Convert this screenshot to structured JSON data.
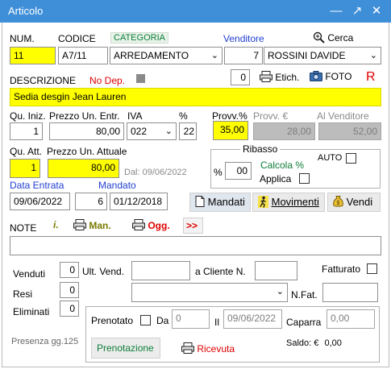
{
  "window": {
    "title": "Articolo",
    "min_glyph": "—",
    "max_glyph": "↗",
    "close_glyph": "✕"
  },
  "row1": {
    "num_label": "NUM.",
    "num_value": "11",
    "codice_label": "CODICE",
    "codice_value": "A7/11",
    "categoria_label": "CATEGORIA",
    "categoria_value": "ARREDAMENTO",
    "venditore_label": "Venditore",
    "venditore_num": "7",
    "venditore_name": "ROSSINI DAVIDE",
    "cerca_label": "Cerca"
  },
  "desc": {
    "label": "DESCRIZIONE",
    "nodep_label": "No Dep.",
    "etich_count": "0",
    "etich_label": "Etich.",
    "foto_label": "FOTO",
    "r_label": "R",
    "value": "Sedia desgin Jean Lauren"
  },
  "prices": {
    "qu_iniz_label": "Qu. Iniz.",
    "qu_iniz": "1",
    "prezzo_entr_label": "Prezzo Un. Entr.",
    "prezzo_entr": "80,00",
    "iva_label": "IVA",
    "iva": "022",
    "pct_label": "%",
    "pct": "22",
    "provv_pct_label": "Provv.%",
    "provv_pct": "35,00",
    "provv_eur_label": "Provv. €",
    "provv_eur": "28,00",
    "al_vend_label": "Al Venditore",
    "al_vend": "52,00"
  },
  "current": {
    "qu_att_label": "Qu. Att.",
    "qu_att": "1",
    "prezzo_att_label": "Prezzo Un. Attuale",
    "prezzo_att": "80,00",
    "dal_label": "Dal: 09/06/2022"
  },
  "ribasso": {
    "label": "Ribasso",
    "auto_label": "AUTO",
    "pct_label": "%",
    "value": "00",
    "calcola_label": "Calcola %",
    "applica_label": "Applica"
  },
  "dates": {
    "entrata_label": "Data Entrata",
    "entrata": "09/06/2022",
    "mandato_label": "Mandato",
    "mandato_num": "6",
    "mandato_date": "01/12/2018"
  },
  "actions": {
    "mandati": "Mandati",
    "movimenti": "Movimenti",
    "vendi": "Vendi"
  },
  "note": {
    "label": "NOTE",
    "i_label": "i.",
    "man_label": "Man.",
    "ogg_label": "Ogg.",
    "more_label": ">>",
    "value": ""
  },
  "sales": {
    "venduti_label": "Venduti",
    "venduti": "0",
    "resi_label": "Resi",
    "resi": "0",
    "eliminati_label": "Eliminati",
    "eliminati": "0",
    "ult_vend_label": "Ult. Vend.",
    "ult_vend": "",
    "a_cliente_label": "a Cliente N.",
    "a_cliente": "",
    "fatturato_label": "Fatturato",
    "nfat_label": "N.Fat.",
    "nfat": ""
  },
  "prenot": {
    "prenotato_label": "Prenotato",
    "da_label": "Da",
    "da_value": "0",
    "il_label": "Il",
    "il_value": "09/06/2022",
    "caparra_label": "Caparra",
    "caparra_value": "0,00",
    "saldo_label": "Saldo:",
    "saldo_currency": "€",
    "saldo_value": "0,00",
    "prenotazione_btn": "Prenotazione",
    "ricevuta_label": "Ricevuta"
  },
  "footer": {
    "presenza": "Presenza gg.125"
  },
  "colors": {
    "titlebar": "#3e8fd8",
    "highlight": "#ffff00",
    "readonly": "#bcbcbc"
  }
}
